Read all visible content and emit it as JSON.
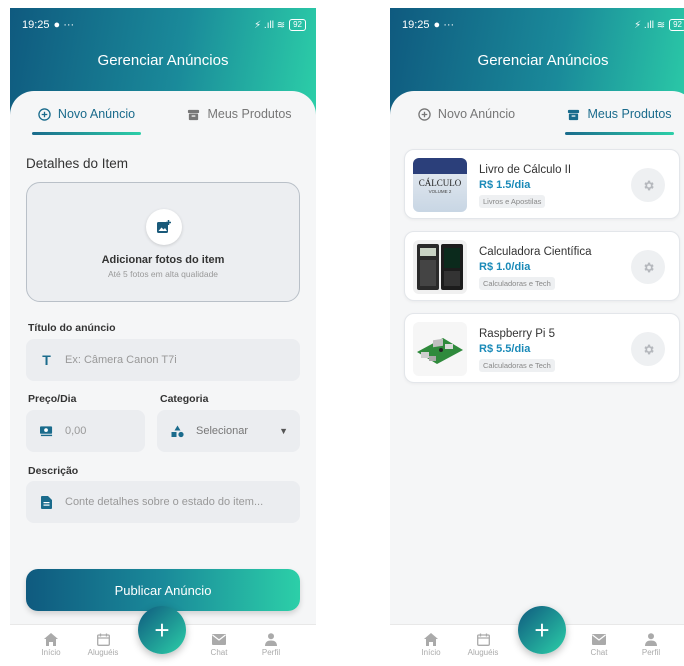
{
  "status_bar": {
    "time": "19:25",
    "battery": "92"
  },
  "header": {
    "title": "Gerenciar Anúncios"
  },
  "tabs": {
    "new_ad": "Novo Anúncio",
    "my_products": "Meus Produtos"
  },
  "form": {
    "section_title": "Detalhes do Item",
    "photos": {
      "label": "Adicionar fotos do item",
      "hint": "Até 5 fotos em alta qualidade"
    },
    "title_label": "Título do anúncio",
    "title_placeholder": "Ex: Câmera Canon T7i",
    "price_label": "Preço/Dia",
    "price_placeholder": "0,00",
    "category_label": "Categoria",
    "category_value": "Selecionar",
    "description_label": "Descrição",
    "description_placeholder": "Conte detalhes sobre o estado do item...",
    "publish_button": "Publicar Anúncio"
  },
  "products": [
    {
      "name": "Livro de Cálculo II",
      "price": "R$ 1.5/dia",
      "category": "Livros e Apostilas",
      "thumb_text": "CÁLCULO",
      "thumb_sub": "VOLUME 2"
    },
    {
      "name": "Calculadora Científica",
      "price": "R$ 1.0/dia",
      "category": "Calculadoras e Tech"
    },
    {
      "name": "Raspberry Pi 5",
      "price": "R$ 5.5/dia",
      "category": "Calculadoras e Tech"
    }
  ],
  "nav": {
    "home": "Início",
    "rentals": "Aluguéis",
    "chat": "Chat",
    "profile": "Perfil",
    "fab": "+"
  },
  "colors": {
    "primary": "#1a6b8c",
    "accent": "#2ccfa8",
    "price": "#1a8ab8"
  }
}
